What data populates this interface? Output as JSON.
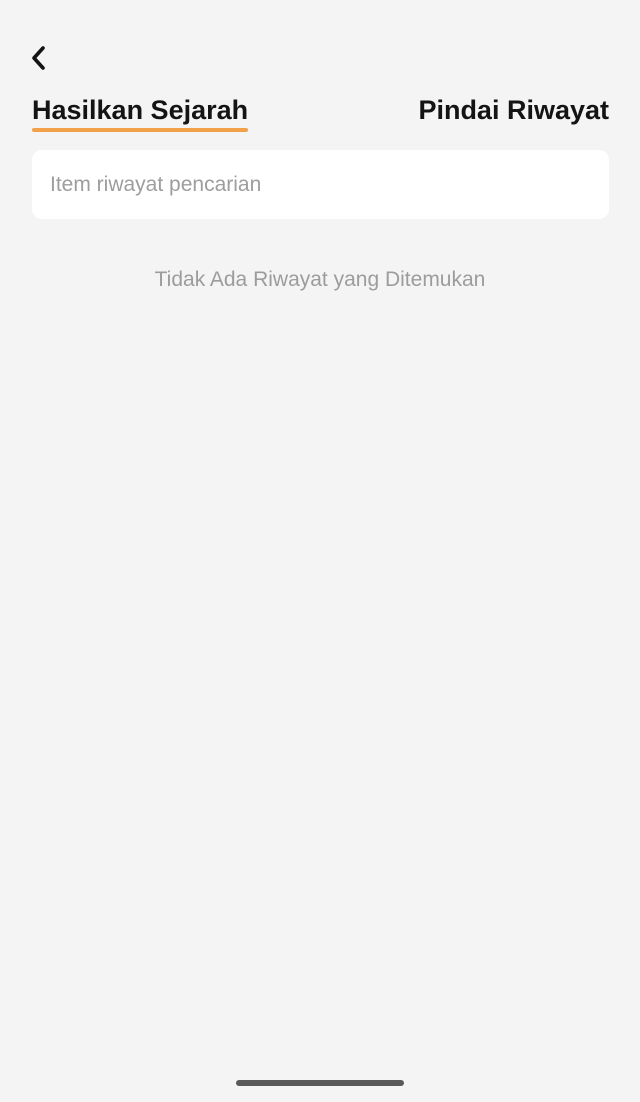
{
  "header": {
    "back_icon": "chevron-left-icon"
  },
  "tabs": [
    {
      "label": "Hasilkan Sejarah",
      "active": true
    },
    {
      "label": "Pindai Riwayat",
      "active": false
    }
  ],
  "search": {
    "placeholder": "Item riwayat pencarian",
    "value": ""
  },
  "empty_state": {
    "message": "Tidak Ada Riwayat yang Ditemukan"
  },
  "colors": {
    "background": "#f4f4f4",
    "accent": "#f2a04a",
    "text_primary": "#141414",
    "text_muted": "#9c9c9c"
  }
}
